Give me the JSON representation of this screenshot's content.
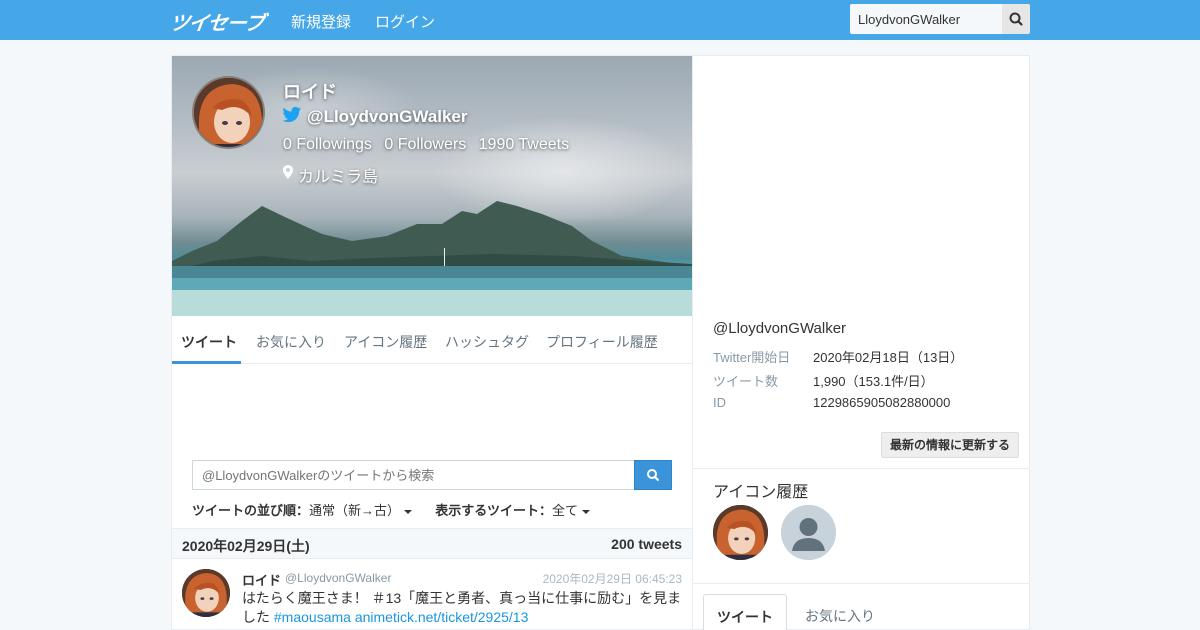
{
  "nav": {
    "logo": "ツイセーブ",
    "register": "新規登録",
    "login": "ログイン",
    "search_value": "LloydvonGWalker"
  },
  "profile": {
    "name": "ロイド",
    "handle": "@LloydvonGWalker",
    "followings": "0 Followings",
    "followers": "0 Followers",
    "tweets": "1990 Tweets",
    "location": "カルミラ島"
  },
  "tabs": [
    "ツイート",
    "お気に入り",
    "アイコン履歴",
    "ハッシュタグ",
    "プロフィール履歴"
  ],
  "tweet_search": {
    "placeholder": "@LloydvonGWalkerのツイートから検索"
  },
  "sort": {
    "order_label": "ツイートの並び順：",
    "order_value": "通常（新→古）",
    "filter_label": "表示するツイート：",
    "filter_value": "全て"
  },
  "day": {
    "date": "2020年02月29日(土)",
    "count": "200 tweets"
  },
  "tweet": {
    "name": "ロイド",
    "handle": "@LloydvonGWalker",
    "time": "2020年02月29日 06:45:23",
    "text": "はたらく魔王さま！ ＃13「魔王と勇者、真っ当に仕事に励む」を見ました",
    "hashtag": "#maousama",
    "link": "animetick.net/ticket/2925/13"
  },
  "info": {
    "handle": "@LloydvonGWalker",
    "start_label": "Twitter開始日",
    "start_value": "2020年02月18日（13日）",
    "count_label": "ツイート数",
    "count_value": "1,990（153.1件/日）",
    "id_label": "ID",
    "id_value": "1229865905082880000",
    "update_button": "最新の情報に更新する"
  },
  "icon_history": {
    "title": "アイコン履歴"
  },
  "right_tabs": {
    "tweets": "ツイート",
    "favorites": "お気に入り"
  },
  "colors": {
    "navbar": "#46a7e8",
    "accent": "#3b94d9",
    "link": "#1b95e0"
  }
}
